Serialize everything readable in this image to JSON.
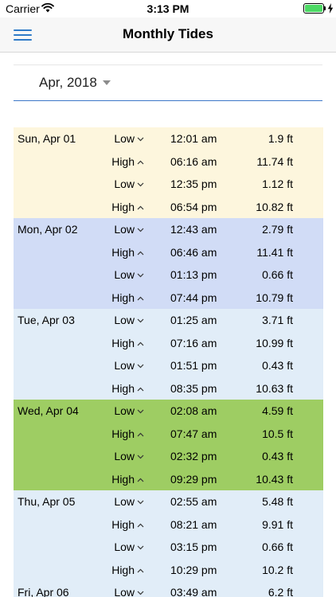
{
  "status": {
    "carrier": "Carrier",
    "time": "3:13 PM"
  },
  "header": {
    "title": "Monthly Tides"
  },
  "month": {
    "selected": "Apr, 2018"
  },
  "colors": {
    "accent": "#2f7bc8",
    "cream": "#fdf6dd",
    "lavender": "#d1dcf6",
    "lightBlue": "#e1edf8",
    "green": "#9ecd63"
  },
  "days": [
    {
      "date": "Sun, Apr 01",
      "color": "#fdf6dd",
      "tides": [
        {
          "type": "Low",
          "dir": "down",
          "time": "12:01 am",
          "height": "1.9 ft"
        },
        {
          "type": "High",
          "dir": "up",
          "time": "06:16 am",
          "height": "11.74 ft"
        },
        {
          "type": "Low",
          "dir": "down",
          "time": "12:35 pm",
          "height": "1.12 ft"
        },
        {
          "type": "High",
          "dir": "up",
          "time": "06:54 pm",
          "height": "10.82 ft"
        }
      ]
    },
    {
      "date": "Mon, Apr 02",
      "color": "#d1dcf6",
      "tides": [
        {
          "type": "Low",
          "dir": "down",
          "time": "12:43 am",
          "height": "2.79 ft"
        },
        {
          "type": "High",
          "dir": "up",
          "time": "06:46 am",
          "height": "11.41 ft"
        },
        {
          "type": "Low",
          "dir": "down",
          "time": "01:13 pm",
          "height": "0.66 ft"
        },
        {
          "type": "High",
          "dir": "up",
          "time": "07:44 pm",
          "height": "10.79 ft"
        }
      ]
    },
    {
      "date": "Tue, Apr 03",
      "color": "#e1edf8",
      "tides": [
        {
          "type": "Low",
          "dir": "down",
          "time": "01:25 am",
          "height": "3.71 ft"
        },
        {
          "type": "High",
          "dir": "up",
          "time": "07:16 am",
          "height": "10.99 ft"
        },
        {
          "type": "Low",
          "dir": "down",
          "time": "01:51 pm",
          "height": "0.43 ft"
        },
        {
          "type": "High",
          "dir": "up",
          "time": "08:35 pm",
          "height": "10.63 ft"
        }
      ]
    },
    {
      "date": "Wed, Apr 04",
      "color": "#9ecd63",
      "tides": [
        {
          "type": "Low",
          "dir": "down",
          "time": "02:08 am",
          "height": "4.59 ft"
        },
        {
          "type": "High",
          "dir": "up",
          "time": "07:47 am",
          "height": "10.5 ft"
        },
        {
          "type": "Low",
          "dir": "down",
          "time": "02:32 pm",
          "height": "0.43 ft"
        },
        {
          "type": "High",
          "dir": "up",
          "time": "09:29 pm",
          "height": "10.43 ft"
        }
      ]
    },
    {
      "date": "Thu, Apr 05",
      "color": "#e1edf8",
      "tides": [
        {
          "type": "Low",
          "dir": "down",
          "time": "02:55 am",
          "height": "5.48 ft"
        },
        {
          "type": "High",
          "dir": "up",
          "time": "08:21 am",
          "height": "9.91 ft"
        },
        {
          "type": "Low",
          "dir": "down",
          "time": "03:15 pm",
          "height": "0.66 ft"
        },
        {
          "type": "High",
          "dir": "up",
          "time": "10:29 pm",
          "height": "10.2 ft"
        }
      ]
    },
    {
      "date": "Fri, Apr 06",
      "color": "#e1edf8",
      "tides": [
        {
          "type": "Low",
          "dir": "down",
          "time": "03:49 am",
          "height": "6.2 ft"
        }
      ]
    }
  ]
}
